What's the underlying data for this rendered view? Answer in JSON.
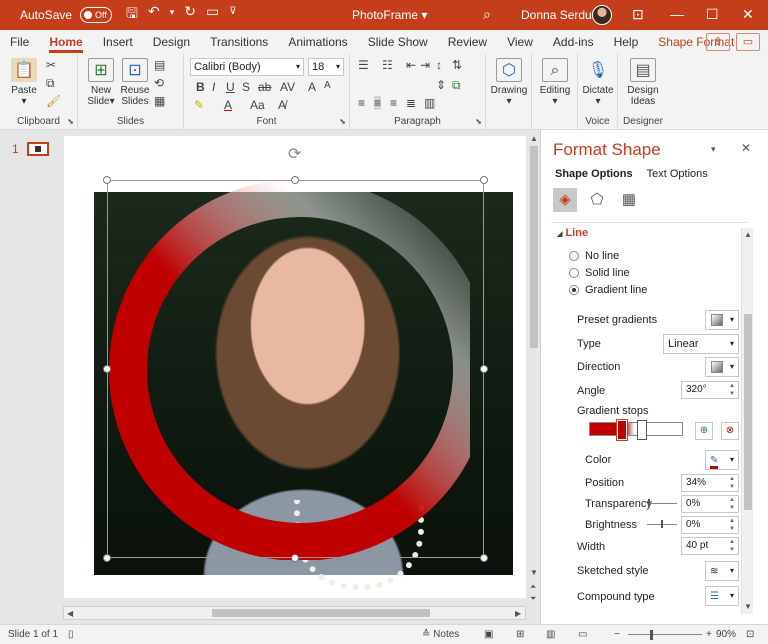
{
  "titlebar": {
    "autosave_label": "AutoSave",
    "autosave_state": "Off",
    "title": "PhotoFrame",
    "title_dropdown": "▾",
    "user": "Donna Serdula",
    "icons": [
      "save-icon",
      "undo-icon",
      "redo-icon",
      "customize-qat-icon",
      "search-icon",
      "ribbon-display-icon",
      "minimize-icon",
      "maximize-icon",
      "close-icon"
    ]
  },
  "tabs": [
    "File",
    "Home",
    "Insert",
    "Design",
    "Transitions",
    "Animations",
    "Slide Show",
    "Review",
    "View",
    "Add-ins",
    "Help",
    "Shape Format"
  ],
  "active_tab": "Home",
  "ribbon": {
    "groups": {
      "clipboard": "Clipboard",
      "slides": "Slides",
      "font": "Font",
      "paragraph": "Paragraph",
      "voice": "Voice",
      "designer": "Designer"
    },
    "paste": "Paste",
    "new_slide": "New Slide",
    "new_slide_arrow": "▾",
    "reuse_slides": "Reuse Slides",
    "font_name": "Calibri (Body)",
    "font_size": "18",
    "drawing": "Drawing",
    "editing": "Editing",
    "dictate": "Dictate",
    "design_ideas": "Design Ideas"
  },
  "thumbs": {
    "slide_number": "1"
  },
  "pane": {
    "title": "Format Shape",
    "tab_shape": "Shape Options",
    "tab_text": "Text Options",
    "section": "Line",
    "section_arrow": "◢",
    "radios": [
      {
        "label": "No line",
        "checked": false
      },
      {
        "label": "Solid line",
        "checked": false
      },
      {
        "label": "Gradient line",
        "checked": true
      }
    ],
    "preset_gradients": "Preset gradients",
    "type_label": "Type",
    "type_value": "Linear",
    "direction_label": "Direction",
    "angle_label": "Angle",
    "angle_value": "320°",
    "gradient_stops": "Gradient stops",
    "color_label": "Color",
    "position_label": "Position",
    "position_value": "34%",
    "transparency_label": "Transparency",
    "transparency_value": "0%",
    "brightness_label": "Brightness",
    "brightness_value": "0%",
    "width_label": "Width",
    "width_value": "40 pt",
    "sketched_label": "Sketched style",
    "compound_label": "Compound type"
  },
  "status": {
    "slide": "Slide 1 of 1",
    "notes": "Notes",
    "zoom_minus": "−",
    "zoom_plus": "+",
    "zoom": "90%"
  },
  "colors": {
    "accent": "#c43e1c",
    "gradient_stop": "#c00000"
  }
}
